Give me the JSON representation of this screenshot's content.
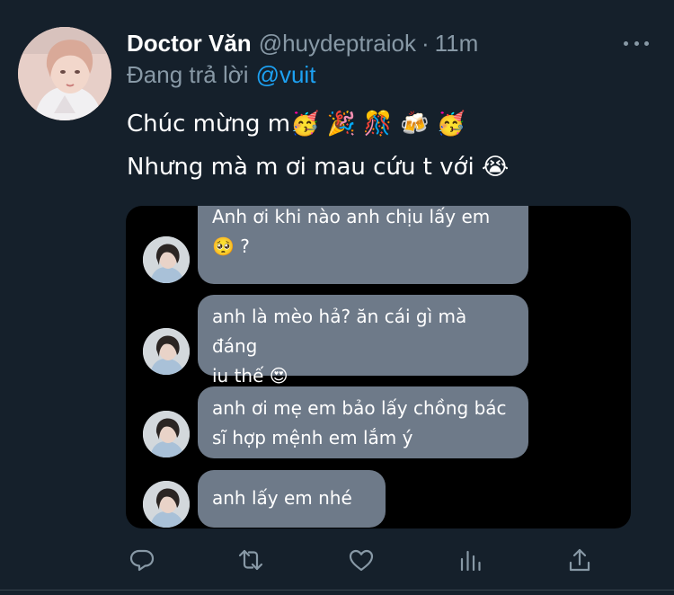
{
  "tweet": {
    "display_name": "Doctor Văn",
    "handle": "@huydeptraiok",
    "separator": "·",
    "time": "11m",
    "reply_prefix": "Đang trả lời",
    "reply_to": "@vuit",
    "text_line1": "Chúc mừng m🥳 🎉 🎊 🍻 🥳",
    "text_line2": "Nhưng mà m ơi mau cứu t với 😭"
  },
  "chat": {
    "messages": [
      {
        "line1": "Anh ơi khi nào anh chịu lấy em",
        "line2": "🥺 ?"
      },
      {
        "line1": "anh là mèo hả? ăn cái gì mà đáng",
        "line2": "iu thế 😍"
      },
      {
        "line1": "anh ơi mẹ em bảo lấy chồng bác",
        "line2": "sĩ hợp mệnh em lắm ý"
      },
      {
        "line1": "anh lấy em nhé🥺",
        "line2": ""
      }
    ]
  },
  "icons": {
    "more": "more-horizontal-icon",
    "reply": "reply-icon",
    "retweet": "retweet-icon",
    "like": "like-icon",
    "analytics": "analytics-icon",
    "share": "share-icon"
  },
  "colors": {
    "background": "#15202b",
    "text": "#ffffff",
    "secondary": "#8899a6",
    "link": "#1da1f2",
    "bubble": "#6e7a89"
  }
}
